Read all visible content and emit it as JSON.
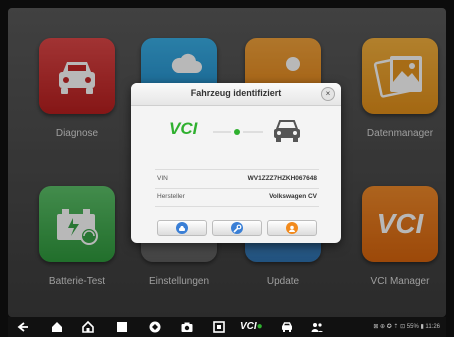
{
  "tiles": [
    {
      "label": "Diagnose"
    },
    {
      "label": ""
    },
    {
      "label": ""
    },
    {
      "label": "Datenmanager"
    },
    {
      "label": "Batterie-Test"
    },
    {
      "label": "Einstellungen"
    },
    {
      "label": "Update"
    },
    {
      "label": "VCI Manager"
    }
  ],
  "vci_logo_text": "VCI",
  "dialog": {
    "title": "Fahrzeug identifiziert",
    "close_symbol": "×",
    "vci_badge": "VCI",
    "vin_label": "VIN",
    "vin_value": "WV1ZZZ7HZKH067648",
    "manufacturer_label": "Hersteller",
    "manufacturer_value": "Volkswagen CV",
    "buttons": [
      {
        "icon": "car-icon",
        "color": "#3a7fd6"
      },
      {
        "icon": "wrench-icon",
        "color": "#3a7fd6"
      },
      {
        "icon": "person-icon",
        "color": "#f28a1c"
      }
    ]
  },
  "status_bar": {
    "text": "⊠ ⊕ ✪ ⇡ ⊡ 55% ▮ 11:26"
  },
  "nav_icons": [
    "back-icon",
    "home-icon",
    "house-icon",
    "recent-apps-icon",
    "browser-icon",
    "camera-icon",
    "screen-capture-icon",
    "vci-icon",
    "car-icon",
    "people-icon"
  ]
}
